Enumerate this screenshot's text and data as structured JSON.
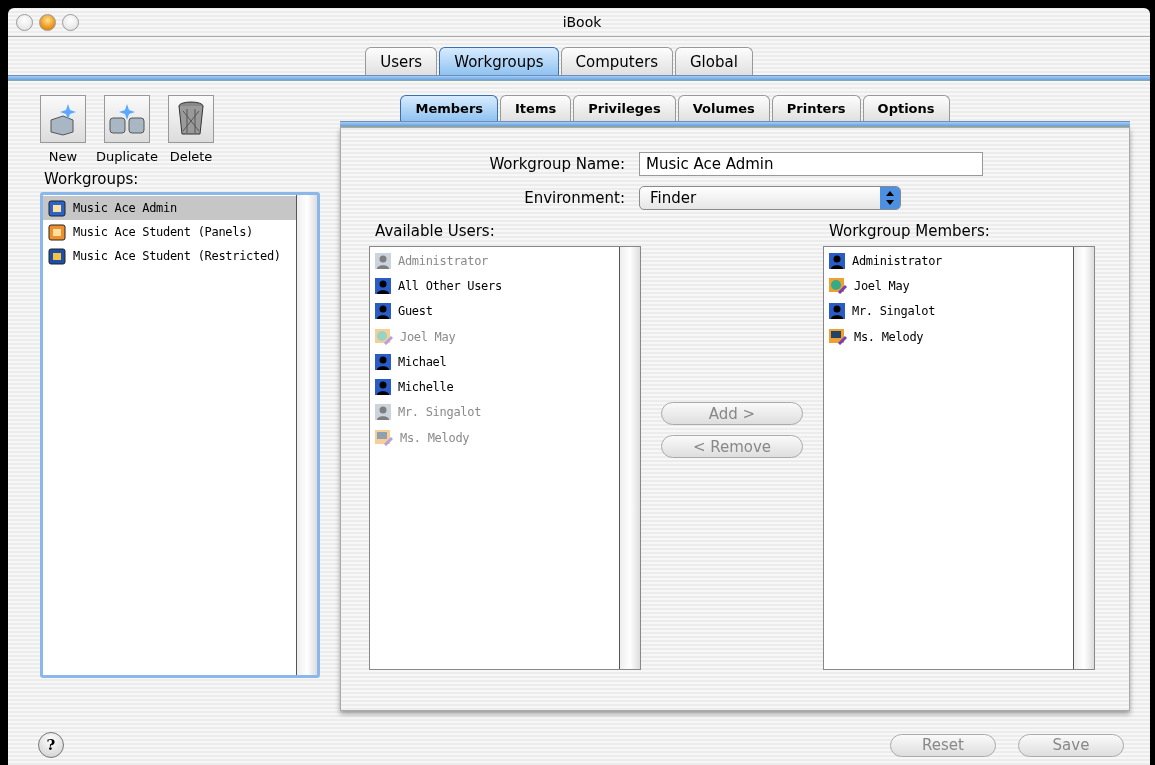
{
  "window": {
    "title": "iBook"
  },
  "tabs": [
    {
      "label": "Users",
      "selected": false
    },
    {
      "label": "Workgroups",
      "selected": true
    },
    {
      "label": "Computers",
      "selected": false
    },
    {
      "label": "Global",
      "selected": false
    }
  ],
  "toolbar": [
    {
      "label": "New",
      "kind": "new"
    },
    {
      "label": "Duplicate",
      "kind": "duplicate"
    },
    {
      "label": "Delete",
      "kind": "delete"
    }
  ],
  "workgroups": {
    "label": "Workgroups:",
    "items": [
      {
        "name": "Music Ace Admin",
        "kind": "finder",
        "selected": true
      },
      {
        "name": "Music Ace Student (Panels)",
        "kind": "panels",
        "selected": false
      },
      {
        "name": "Music Ace Student (Restricted)",
        "kind": "restricted",
        "selected": false
      }
    ]
  },
  "subtabs": [
    {
      "label": "Members",
      "selected": true
    },
    {
      "label": "Items",
      "selected": false
    },
    {
      "label": "Privileges",
      "selected": false
    },
    {
      "label": "Volumes",
      "selected": false
    },
    {
      "label": "Printers",
      "selected": false
    },
    {
      "label": "Options",
      "selected": false
    }
  ],
  "workgroup_name": {
    "label": "Workgroup Name:",
    "value": "Music Ace Admin"
  },
  "environment": {
    "label": "Environment:",
    "value": "Finder"
  },
  "available_users": {
    "label": "Available Users:",
    "items": [
      {
        "name": "Administrator",
        "kind": "person",
        "disabled": true
      },
      {
        "name": "All Other Users",
        "kind": "person",
        "disabled": false
      },
      {
        "name": "Guest",
        "kind": "person",
        "disabled": false
      },
      {
        "name": "Joel May",
        "kind": "globe",
        "disabled": true
      },
      {
        "name": "Michael",
        "kind": "person",
        "disabled": false
      },
      {
        "name": "Michelle",
        "kind": "person",
        "disabled": false
      },
      {
        "name": "Mr. Singalot",
        "kind": "person",
        "disabled": true
      },
      {
        "name": "Ms. Melody",
        "kind": "computer",
        "disabled": true
      }
    ]
  },
  "add_button": {
    "label": "Add >",
    "disabled": true
  },
  "remove_button": {
    "label": "< Remove",
    "disabled": true
  },
  "workgroup_members": {
    "label": "Workgroup Members:",
    "items": [
      {
        "name": "Administrator",
        "kind": "person",
        "disabled": false
      },
      {
        "name": "Joel May",
        "kind": "globe",
        "disabled": false
      },
      {
        "name": "Mr. Singalot",
        "kind": "person",
        "disabled": false
      },
      {
        "name": "Ms. Melody",
        "kind": "computer",
        "disabled": false
      }
    ]
  },
  "help_button": {
    "label": "?"
  },
  "reset_button": {
    "label": "Reset",
    "disabled": true
  },
  "save_button": {
    "label": "Save",
    "disabled": true
  }
}
